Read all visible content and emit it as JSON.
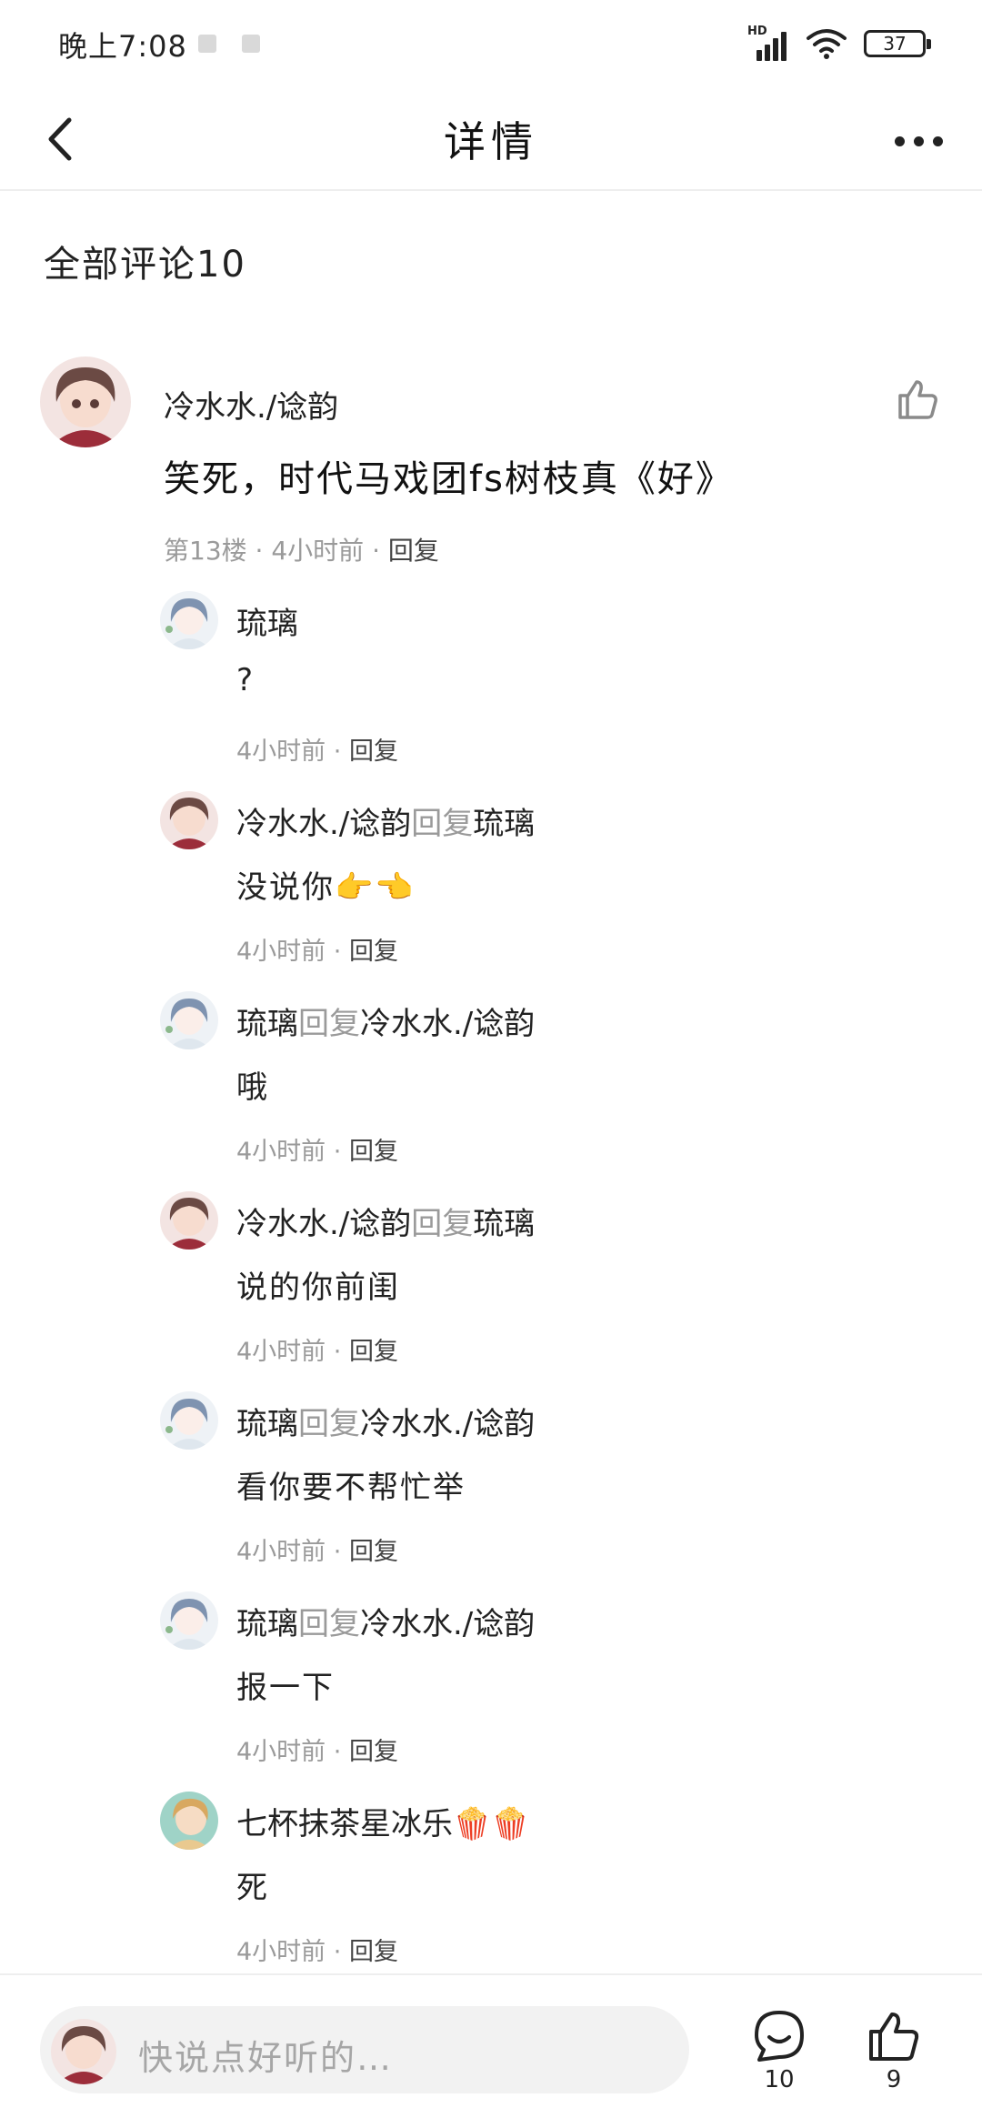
{
  "status_bar": {
    "time": "晚上7:08",
    "network": "HD",
    "battery": "37"
  },
  "nav": {
    "title": "详情"
  },
  "comments_header": "全部评论10",
  "main_comment": {
    "author": "冷水水./谂韵",
    "text": "笑死，时代马戏团fs树枝真《好》",
    "floor": "第13楼",
    "time": "4小时前",
    "reply_label": "回复"
  },
  "replies": [
    {
      "author": "琉璃",
      "reply_word": "",
      "target": "",
      "text": "?",
      "time": "4小时前",
      "reply_label": "回复"
    },
    {
      "author": "冷水水./谂韵",
      "reply_word": "回复",
      "target": "琉璃",
      "text": "没说你👉👈",
      "time": "4小时前",
      "reply_label": "回复"
    },
    {
      "author": "琉璃",
      "reply_word": "回复",
      "target": "冷水水./谂韵",
      "text": "哦",
      "time": "4小时前",
      "reply_label": "回复"
    },
    {
      "author": "冷水水./谂韵",
      "reply_word": "回复",
      "target": "琉璃",
      "text": "说的你前闺",
      "time": "4小时前",
      "reply_label": "回复"
    },
    {
      "author": "琉璃",
      "reply_word": "回复",
      "target": "冷水水./谂韵",
      "text": "看你要不帮忙举",
      "time": "4小时前",
      "reply_label": "回复"
    },
    {
      "author": "琉璃",
      "reply_word": "回复",
      "target": "冷水水./谂韵",
      "text": "报一下",
      "time": "4小时前",
      "reply_label": "回复"
    },
    {
      "author": "七杯抹茶星冰乐🍿🍿",
      "reply_word": "",
      "target": "",
      "text": "死",
      "time": "4小时前",
      "reply_label": "回复"
    }
  ],
  "bottom_bar": {
    "input_placeholder": "快说点好听的…",
    "comment_count": "10",
    "like_count": "9"
  },
  "colors": {
    "meta_gray": "#9a9a9a",
    "text_dark": "#222222",
    "input_bg": "#f2f2f2"
  }
}
